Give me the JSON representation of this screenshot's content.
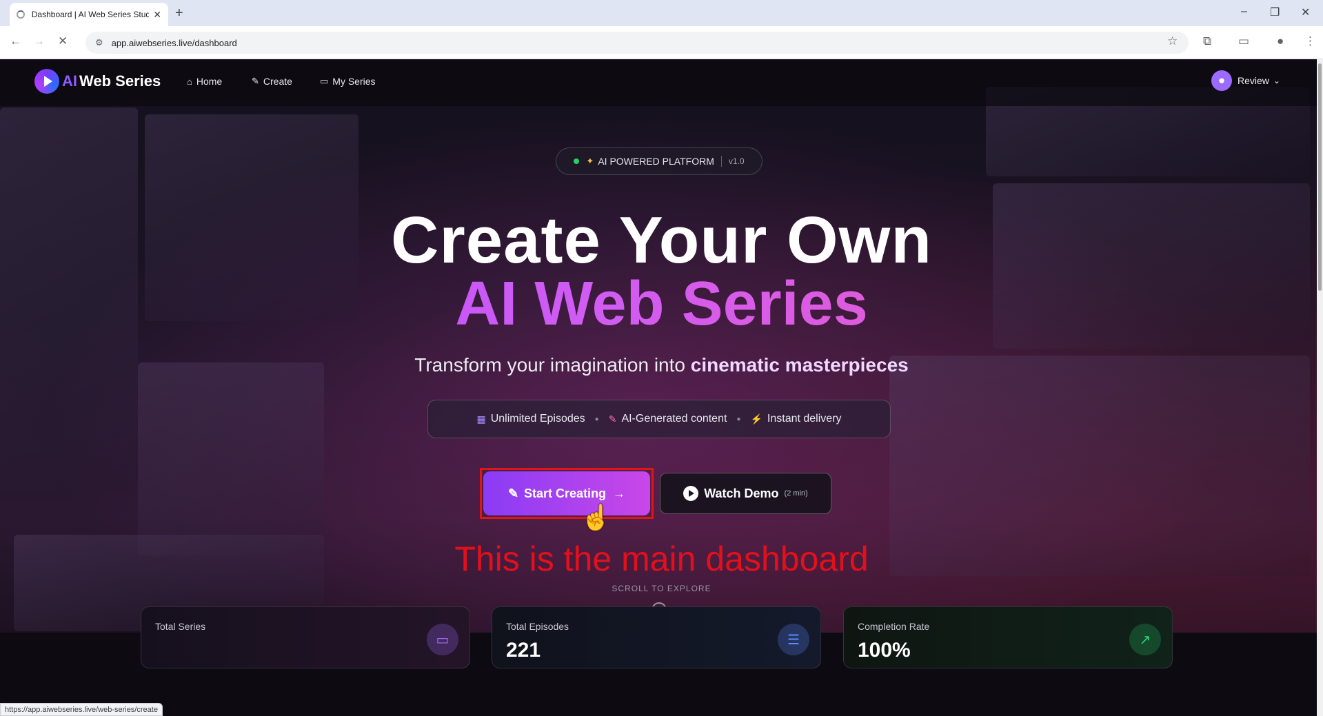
{
  "browser": {
    "tab_title": "Dashboard | AI Web Series Stud",
    "new_tab": "+",
    "close_tab": "✕",
    "url": "app.aiwebseries.live/dashboard",
    "status_url": "https://app.aiwebseries.live/web-series/create"
  },
  "navbar": {
    "logo_ai": "AI",
    "logo_text": "Web Series",
    "items": [
      {
        "label": "Home",
        "icon": "home-icon"
      },
      {
        "label": "Create",
        "icon": "pencil-icon"
      },
      {
        "label": "My Series",
        "icon": "monitor-icon"
      }
    ],
    "user_name": "Review"
  },
  "hero": {
    "badge_text": "AI POWERED PLATFORM",
    "badge_version": "v1.0",
    "title_line1": "Create Your Own",
    "title_line2": "AI Web Series",
    "subtitle_plain": "Transform your imagination into",
    "subtitle_highlight": "cinematic masterpieces",
    "features": [
      {
        "label": "Unlimited Episodes",
        "icon": "film-icon"
      },
      {
        "label": "AI-Generated content",
        "icon": "pencil-icon"
      },
      {
        "label": "Instant delivery",
        "icon": "lightning-icon"
      }
    ],
    "start_button": "Start Creating",
    "demo_button": "Watch Demo",
    "demo_duration": "(2 min)",
    "scroll_hint": "SCROLL TO EXPLORE"
  },
  "annotation": {
    "caption": "This is the main dashboard",
    "highlight_color": "#e31414"
  },
  "stats": [
    {
      "label": "Total Series",
      "value": "",
      "icon": "monitor-icon",
      "accent": "#a56bff"
    },
    {
      "label": "Total Episodes",
      "value": "221",
      "icon": "list-icon",
      "accent": "#5b8cff"
    },
    {
      "label": "Completion Rate",
      "value": "100%",
      "icon": "chart-up-icon",
      "accent": "#2ed573"
    }
  ],
  "colors": {
    "brand_purple": "#8a3cf5",
    "brand_pink": "#c947e8",
    "status_green": "#22d36a"
  }
}
